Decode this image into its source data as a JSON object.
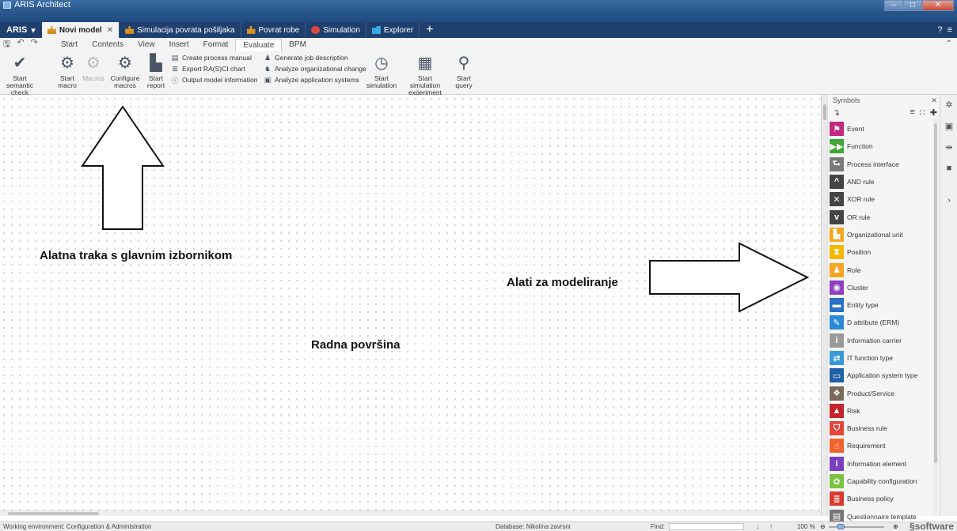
{
  "window": {
    "title": "ARIS Architect",
    "controls": [
      "–",
      "□",
      "✕"
    ]
  },
  "tabbar": {
    "menu_label": "ARIS",
    "tabs": [
      {
        "label": "Novi model",
        "icon": "process-tree-icon",
        "active": true
      },
      {
        "label": "Simulacija povrata pošiljaka",
        "icon": "process-tree-icon"
      },
      {
        "label": "Povrat robe",
        "icon": "process-tree-icon"
      },
      {
        "label": "Simulation",
        "icon": "simulation-icon"
      },
      {
        "label": "Explorer",
        "icon": "explorer-icon"
      }
    ],
    "add_label": "+",
    "help_label": "?"
  },
  "ribbon": {
    "tabs": [
      "Start",
      "Contents",
      "View",
      "Insert",
      "Format",
      "Evaluate",
      "BPM"
    ],
    "active_tab": "Evaluate",
    "buttons": {
      "semantic_check": "Start semantic check",
      "start_macro": "Start macro",
      "macros": "Macros",
      "configure_macros": "Configure macros",
      "start_report": "Start report",
      "start_simulation": "Start simulation",
      "start_simulation_experiment": "Start simulation experiment",
      "start_query": "Start query"
    },
    "report_items": [
      "Create process manual",
      "Export RA(S)CI chart",
      "Output model information"
    ],
    "org_items": [
      "Generate job description",
      "Analyze organizational change",
      "Analyze application systems"
    ]
  },
  "canvas": {
    "annotations": {
      "toolbar": "Alatna traka s glavnim izbornikom",
      "modeling": "Alati za modeliranje",
      "workspace": "Radna površina"
    }
  },
  "symbols": {
    "title": "Symbols",
    "items": [
      {
        "label": "Event",
        "color": "#c2297f",
        "glyph": "⚑"
      },
      {
        "label": "Function",
        "color": "#3fa535",
        "glyph": "▶▶"
      },
      {
        "label": "Process interface",
        "color": "#7a7a7a",
        "glyph": "⮑"
      },
      {
        "label": "AND rule",
        "color": "#444444",
        "glyph": "^"
      },
      {
        "label": "XOR rule",
        "color": "#444444",
        "glyph": "✕"
      },
      {
        "label": "OR rule",
        "color": "#444444",
        "glyph": "v"
      },
      {
        "label": "Organizational unit",
        "color": "#f5a623",
        "glyph": "▙"
      },
      {
        "label": "Position",
        "color": "#f5b800",
        "glyph": "⧗"
      },
      {
        "label": "Role",
        "color": "#f5a623",
        "glyph": "♟"
      },
      {
        "label": "Cluster",
        "color": "#8e3fbf",
        "glyph": "◉"
      },
      {
        "label": "Entity type",
        "color": "#2a72c7",
        "glyph": "▬"
      },
      {
        "label": "D attribute (ERM)",
        "color": "#2a8ad7",
        "glyph": "✎"
      },
      {
        "label": "Information carrier",
        "color": "#9a9a9a",
        "glyph": "i"
      },
      {
        "label": "IT function type",
        "color": "#3a9ad9",
        "glyph": "⇄"
      },
      {
        "label": "Application system type",
        "color": "#1f5fa8",
        "glyph": "▭"
      },
      {
        "label": "Product/Service",
        "color": "#7a6a5a",
        "glyph": "❖"
      },
      {
        "label": "Risk",
        "color": "#c1272d",
        "glyph": "▲"
      },
      {
        "label": "Business rule",
        "color": "#e2463a",
        "glyph": "⛉"
      },
      {
        "label": "Requirement",
        "color": "#f0642c",
        "glyph": "☝"
      },
      {
        "label": "Information element",
        "color": "#7a3fbf",
        "glyph": "i"
      },
      {
        "label": "Capability configuration",
        "color": "#7cc242",
        "glyph": "✿"
      },
      {
        "label": "Business policy",
        "color": "#d83a2e",
        "glyph": "≣"
      },
      {
        "label": "Questionnaire template",
        "color": "#777777",
        "glyph": "▤"
      }
    ]
  },
  "statusbar": {
    "environment": "Working environment: Configuration & Administration",
    "database": "Database: Nikolina zavrsni",
    "find_label": "Find:",
    "zoom": "100 %",
    "brand": "software"
  }
}
